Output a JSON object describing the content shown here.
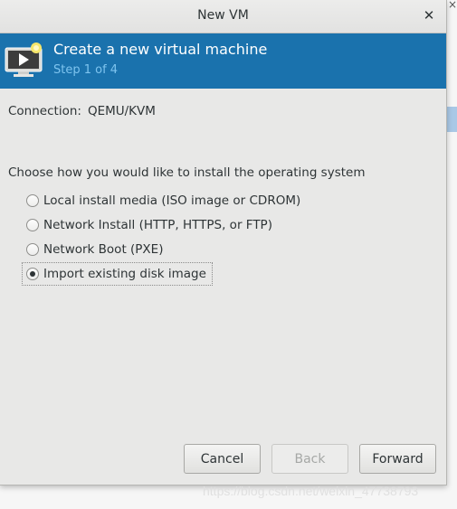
{
  "window": {
    "title": "New VM",
    "close_glyph": "✕"
  },
  "banner": {
    "icon": "vm-monitor-icon",
    "title": "Create a new virtual machine",
    "step": "Step 1 of 4"
  },
  "connection": {
    "label": "Connection:",
    "value": "QEMU/KVM"
  },
  "install": {
    "prompt": "Choose how you would like to install the operating system",
    "options": [
      {
        "label": "Local install media (ISO image or CDROM)",
        "selected": false
      },
      {
        "label": "Network Install (HTTP, HTTPS, or FTP)",
        "selected": false
      },
      {
        "label": "Network Boot (PXE)",
        "selected": false
      },
      {
        "label": "Import existing disk image",
        "selected": true
      }
    ]
  },
  "buttons": {
    "cancel": "Cancel",
    "back": "Back",
    "forward": "Forward"
  },
  "watermark": "https://blog.csdn.net/weixin_47738793",
  "colors": {
    "banner": "#1a72ad",
    "banner_subtitle": "#7ec4ef"
  }
}
